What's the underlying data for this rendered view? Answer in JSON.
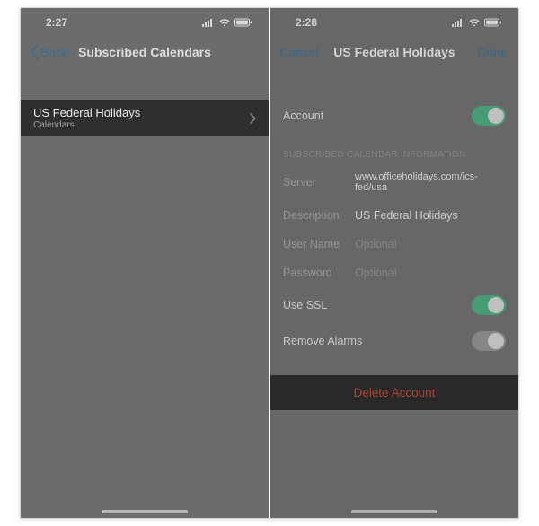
{
  "left": {
    "status_time": "2:27",
    "back_label": "Back",
    "nav_title": "Subscribed Calendars",
    "item_title": "US Federal Holidays",
    "item_subtitle": "Calendars"
  },
  "right": {
    "status_time": "2:28",
    "cancel_label": "Cancel",
    "nav_title": "US Federal Holidays",
    "done_label": "Done",
    "account_label": "Account",
    "account_on": true,
    "section_header": "SUBSCRIBED CALENDAR INFORMATION",
    "server_label": "Server",
    "server_value": "www.officeholidays.com/ics-fed/usa",
    "description_label": "Description",
    "description_value": "US Federal Holidays",
    "username_label": "User Name",
    "username_placeholder": "Optional",
    "password_label": "Password",
    "password_placeholder": "Optional",
    "ssl_label": "Use SSL",
    "ssl_on": true,
    "alarms_label": "Remove Alarms",
    "alarms_on": false,
    "delete_label": "Delete Account"
  }
}
